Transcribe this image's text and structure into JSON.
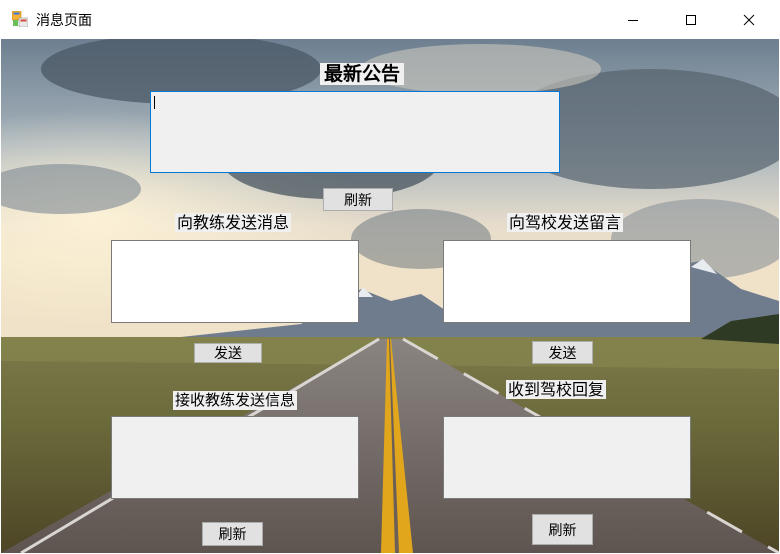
{
  "window": {
    "title": "消息页面",
    "icon": "windows-forms-app-icon"
  },
  "controls": {
    "minimize_icon": "minimize-icon",
    "maximize_icon": "maximize-icon",
    "close_icon": "close-icon"
  },
  "announcements": {
    "title": "最新公告",
    "content": "",
    "refresh_label": "刷新"
  },
  "send_to_coach": {
    "label": "向教练发送消息",
    "value": "",
    "send_label": "发送"
  },
  "send_to_school": {
    "label": "向驾校发送留言",
    "value": "",
    "send_label": "发送"
  },
  "receive_from_coach": {
    "label": "接收教练发送信息",
    "content": "",
    "refresh_label": "刷新"
  },
  "receive_from_school": {
    "label": "收到驾校回复",
    "content": "",
    "refresh_label": "刷新"
  },
  "colors": {
    "focus_border": "#0078d7",
    "control_face": "#f0f0f0",
    "button_face": "#e1e1e1"
  }
}
